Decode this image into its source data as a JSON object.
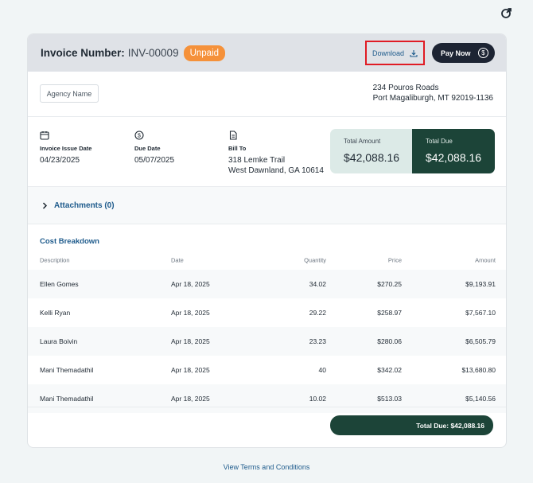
{
  "header": {
    "invoice_label": "Invoice Number:",
    "invoice_number": "INV-00009",
    "status_badge": "Unpaid",
    "download_label": "Download",
    "pay_now_label": "Pay Now",
    "accent_color": "#1c4438",
    "badge_color": "#f5913a"
  },
  "agency": {
    "name": "Agency Name",
    "address_line1": "234 Pouros Roads",
    "address_line2": "Port Magaliburgh, MT 92019-1136"
  },
  "info": {
    "issue_date_label": "Invoice Issue Date",
    "issue_date": "04/23/2025",
    "due_date_label": "Due Date",
    "due_date": "05/07/2025",
    "bill_to_label": "Bill To",
    "bill_to_line1": "318 Lemke Trail",
    "bill_to_line2": "West Dawnland, GA 10614"
  },
  "totals": {
    "total_amount_label": "Total Amount",
    "total_amount": "$42,088.16",
    "total_due_label": "Total Due",
    "total_due": "$42,088.16"
  },
  "attachments": {
    "label": "Attachments (0)"
  },
  "cost_breakdown": {
    "title": "Cost Breakdown",
    "columns": [
      "Description",
      "Date",
      "Quantity",
      "Price",
      "Amount"
    ],
    "rows": [
      [
        "Ellen Gomes",
        "Apr 18, 2025",
        "34.02",
        "$270.25",
        "$9,193.91"
      ],
      [
        "Kelli Ryan",
        "Apr 18, 2025",
        "29.22",
        "$258.97",
        "$7,567.10"
      ],
      [
        "Laura Boivin",
        "Apr 18, 2025",
        "23.23",
        "$280.06",
        "$6,505.79"
      ],
      [
        "Mani Themadathil",
        "Apr 18, 2025",
        "40",
        "$342.02",
        "$13,680.80"
      ],
      [
        "Mani Themadathil",
        "Apr 18, 2025",
        "10.02",
        "$513.03",
        "$5,140.56"
      ]
    ],
    "total_due_text": "Total Due: $42,088.16"
  },
  "footer": {
    "terms_link": "View Terms and Conditions"
  }
}
